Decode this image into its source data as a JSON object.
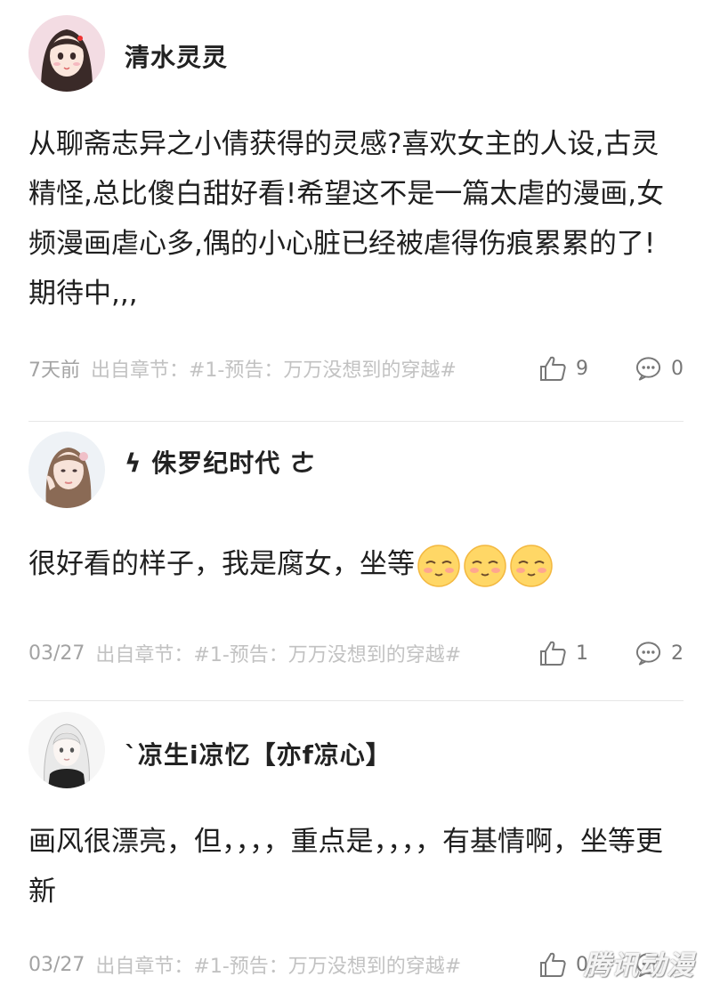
{
  "comments": [
    {
      "username": "清水灵灵",
      "text": "从聊斋志异之小倩获得的灵感?喜欢女主的人设,古灵精怪,总比傻白甜好看!希望这不是一篇太虐的漫画,女频漫画虐心多,偶的小心脏已经被虐得伤痕累累的了!期待中,,,",
      "time": "7天前",
      "source": "出自章节：#1-预告：万万没想到的穿越#",
      "likes": "9",
      "replies": "0"
    },
    {
      "username": "ϟ 侏罗纪时代 ㄜ",
      "text": "很好看的样子，我是腐女，坐等",
      "emojis": [
        "blush-emoji",
        "blush-emoji",
        "blush-emoji"
      ],
      "time": "03/27",
      "source": "出自章节：#1-预告：万万没想到的穿越#",
      "likes": "1",
      "replies": "2"
    },
    {
      "username": "`凉生i凉忆【亦f凉心】",
      "text": "画风很漂亮，但，，，，重点是，，，，有基情啊，坐等更新",
      "time": "03/27",
      "source": "出自章节：#1-预告：万万没想到的穿越#",
      "likes": "0",
      "replies": ""
    }
  ],
  "watermark": "腾讯动漫",
  "icons": {
    "like": "thumbs-up-icon",
    "reply": "comment-bubble-icon"
  },
  "colors": {
    "meta_text": "#a8a8a8",
    "divider": "#e6e6e6"
  }
}
